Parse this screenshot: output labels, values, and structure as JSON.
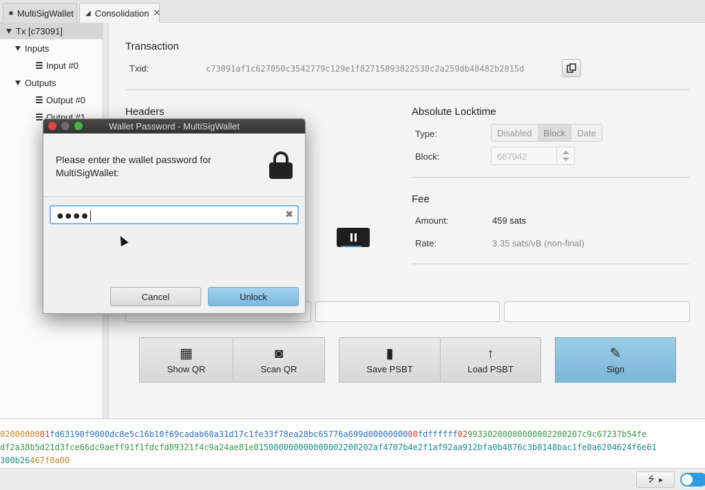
{
  "tabs": [
    {
      "label": "MultiSigWallet",
      "icon": "wallet-icon"
    },
    {
      "label": "Consolidation",
      "icon": "send-icon",
      "close": "✕"
    }
  ],
  "tree": {
    "root": "Tx [c73091]",
    "inputs": "Inputs",
    "input0": "Input #0",
    "outputs": "Outputs",
    "output0": "Output #0",
    "output1": "Output #1"
  },
  "transaction": {
    "title": "Transaction",
    "txid_label": "Txid:",
    "txid": "c73091af1c627050c3542779c129e1f82715893822538c2a259db48482b2815d"
  },
  "headers": {
    "title": "Headers"
  },
  "locktime": {
    "title": "Absolute Locktime",
    "type_label": "Type:",
    "types": [
      "Disabled",
      "Block",
      "Date"
    ],
    "selected": "Block",
    "block_label": "Block:",
    "block_value": "687942"
  },
  "fee": {
    "title": "Fee",
    "amount_label": "Amount:",
    "amount": "459 sats",
    "rate_label": "Rate:",
    "rate": "3.35 sats/vB (non-final)"
  },
  "actions": {
    "show_qr": "Show QR",
    "scan_qr": "Scan QR",
    "save_psbt": "Save PSBT",
    "load_psbt": "Load PSBT",
    "sign": "Sign"
  },
  "hex": {
    "line1": [
      {
        "t": "02000000",
        "c": "c-or"
      },
      {
        "t": "01",
        "c": "c-red"
      },
      {
        "t": "fd63190f9000dc8e5c16b10f69cadab60a31d17c1fe33f78ea28bc65776a699d",
        "c": "c-blu"
      },
      {
        "t": "00000000",
        "c": "c-blu"
      },
      {
        "t": "00",
        "c": "c-red"
      },
      {
        "t": "fdffffff",
        "c": "c-blu"
      },
      {
        "t": "02",
        "c": "c-red"
      },
      {
        "t": "9933020000000000",
        "c": "c-grn"
      },
      {
        "t": "2200207c9c67237b54fe",
        "c": "c-grn"
      }
    ],
    "line2": [
      {
        "t": "df2a38b5d21d3fce66dc9aeff91f1fdcfd89321f4c9a24ae81e0",
        "c": "c-grn"
      },
      {
        "t": "1500000000000000",
        "c": "c-tea"
      },
      {
        "t": "2200202af4707b4e2f1af92aa912bfa0b4876c3b0148bac1fe0a6204624f6e61",
        "c": "c-tea"
      }
    ],
    "line3": [
      {
        "t": "300b26",
        "c": "c-tea"
      },
      {
        "t": "467f0a00",
        "c": "c-or"
      }
    ]
  },
  "dialog": {
    "title": "Wallet Password - MultiSigWallet",
    "message": "Please enter the wallet password for MultiSigWallet:",
    "password_dots": "●●●●",
    "cancel": "Cancel",
    "unlock": "Unlock"
  },
  "colors": {
    "accent": "#2f9be0",
    "sign_button": "#8cc3e0"
  }
}
